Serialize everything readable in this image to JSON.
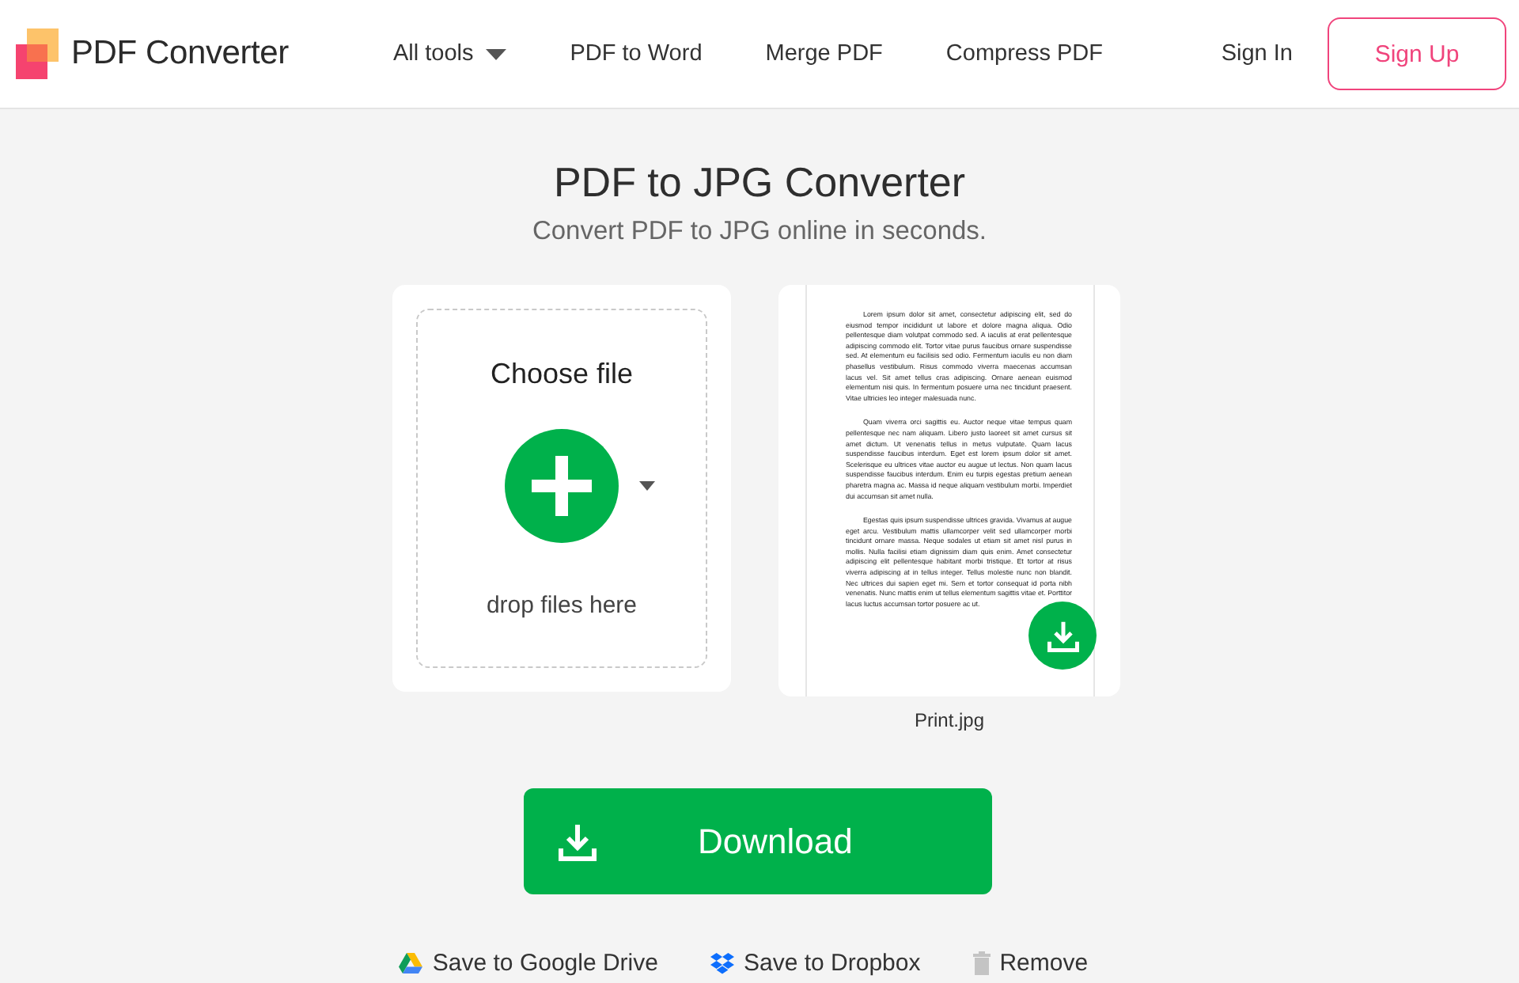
{
  "header": {
    "logo": "PDF Converter",
    "nav": [
      {
        "label": "All tools",
        "kind": "dropdown"
      },
      {
        "label": "PDF to Word",
        "kind": "link"
      },
      {
        "label": "Merge PDF",
        "kind": "link"
      },
      {
        "label": "Compress PDF",
        "kind": "link"
      }
    ],
    "sign_in": "Sign In",
    "sign_up": "Sign Up"
  },
  "hero": {
    "title": "PDF to JPG Converter",
    "subtitle": "Convert PDF to JPG online in seconds."
  },
  "upload": {
    "title": "Choose file",
    "hint": "drop files here"
  },
  "preview": {
    "paragraphs": [
      "Lorem ipsum dolor sit amet, consectetur adipiscing elit, sed do eiusmod tempor incididunt ut labore et dolore magna aliqua. Odio pellentesque diam volutpat commodo sed. A iaculis at erat pellentesque adipiscing commodo elit. Tortor vitae purus faucibus ornare suspendisse sed. At elementum eu facilisis sed odio. Fermentum iaculis eu non diam phasellus vestibulum. Risus commodo viverra maecenas accumsan lacus vel. Sit amet tellus cras adipiscing. Ornare aenean euismod elementum nisi quis. In fermentum posuere urna nec tincidunt praesent. Vitae ultricies leo integer malesuada nunc.",
      "Quam viverra orci sagittis eu. Auctor neque vitae tempus quam pellentesque nec nam aliquam. Libero justo laoreet sit amet cursus sit amet dictum. Ut venenatis tellus in metus vulputate. Quam lacus suspendisse faucibus interdum. Eget est lorem ipsum dolor sit amet. Scelerisque eu ultrices vitae auctor eu augue ut lectus. Non quam lacus suspendisse faucibus interdum. Enim eu turpis egestas pretium aenean pharetra magna ac. Massa id neque aliquam vestibulum morbi. Imperdiet dui accumsan sit amet nulla.",
      "Egestas quis ipsum suspendisse ultrices gravida. Vivamus at augue eget arcu. Vestibulum mattis ullamcorper velit sed ullamcorper morbi tincidunt ornare massa. Neque sodales ut etiam sit amet nisl purus in mollis. Nulla facilisi etiam dignissim diam quis enim. Amet consectetur adipiscing elit pellentesque habitant morbi tristique. Et tortor at risus viverra adipiscing at in tellus integer. Tellus molestie nunc non blandit. Nec ultrices dui sapien eget mi. Sem et tortor consequat id porta nibh venenatis. Nunc mattis enim ut tellus elementum sagittis vitae et. Porttitor lacus luctus accumsan tortor posuere ac ut."
    ],
    "file_name": "Print.jpg"
  },
  "download_button": "Download",
  "actions": [
    {
      "label": "Save to Google Drive",
      "kind": "google_drive"
    },
    {
      "label": "Save to Dropbox",
      "kind": "dropbox"
    },
    {
      "label": "Remove",
      "kind": "remove"
    }
  ]
}
